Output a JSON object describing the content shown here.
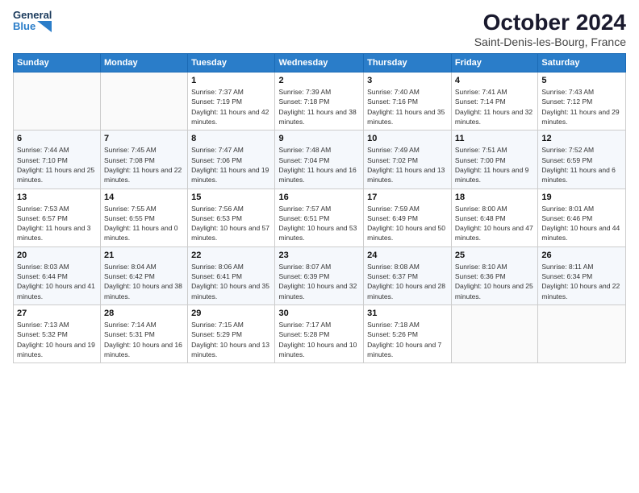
{
  "header": {
    "logo_line1": "General",
    "logo_line2": "Blue",
    "month": "October 2024",
    "location": "Saint-Denis-les-Bourg, France"
  },
  "columns": [
    "Sunday",
    "Monday",
    "Tuesday",
    "Wednesday",
    "Thursday",
    "Friday",
    "Saturday"
  ],
  "weeks": [
    [
      {
        "day": "",
        "info": ""
      },
      {
        "day": "",
        "info": ""
      },
      {
        "day": "1",
        "info": "Sunrise: 7:37 AM\nSunset: 7:19 PM\nDaylight: 11 hours and 42 minutes."
      },
      {
        "day": "2",
        "info": "Sunrise: 7:39 AM\nSunset: 7:18 PM\nDaylight: 11 hours and 38 minutes."
      },
      {
        "day": "3",
        "info": "Sunrise: 7:40 AM\nSunset: 7:16 PM\nDaylight: 11 hours and 35 minutes."
      },
      {
        "day": "4",
        "info": "Sunrise: 7:41 AM\nSunset: 7:14 PM\nDaylight: 11 hours and 32 minutes."
      },
      {
        "day": "5",
        "info": "Sunrise: 7:43 AM\nSunset: 7:12 PM\nDaylight: 11 hours and 29 minutes."
      }
    ],
    [
      {
        "day": "6",
        "info": "Sunrise: 7:44 AM\nSunset: 7:10 PM\nDaylight: 11 hours and 25 minutes."
      },
      {
        "day": "7",
        "info": "Sunrise: 7:45 AM\nSunset: 7:08 PM\nDaylight: 11 hours and 22 minutes."
      },
      {
        "day": "8",
        "info": "Sunrise: 7:47 AM\nSunset: 7:06 PM\nDaylight: 11 hours and 19 minutes."
      },
      {
        "day": "9",
        "info": "Sunrise: 7:48 AM\nSunset: 7:04 PM\nDaylight: 11 hours and 16 minutes."
      },
      {
        "day": "10",
        "info": "Sunrise: 7:49 AM\nSunset: 7:02 PM\nDaylight: 11 hours and 13 minutes."
      },
      {
        "day": "11",
        "info": "Sunrise: 7:51 AM\nSunset: 7:00 PM\nDaylight: 11 hours and 9 minutes."
      },
      {
        "day": "12",
        "info": "Sunrise: 7:52 AM\nSunset: 6:59 PM\nDaylight: 11 hours and 6 minutes."
      }
    ],
    [
      {
        "day": "13",
        "info": "Sunrise: 7:53 AM\nSunset: 6:57 PM\nDaylight: 11 hours and 3 minutes."
      },
      {
        "day": "14",
        "info": "Sunrise: 7:55 AM\nSunset: 6:55 PM\nDaylight: 11 hours and 0 minutes."
      },
      {
        "day": "15",
        "info": "Sunrise: 7:56 AM\nSunset: 6:53 PM\nDaylight: 10 hours and 57 minutes."
      },
      {
        "day": "16",
        "info": "Sunrise: 7:57 AM\nSunset: 6:51 PM\nDaylight: 10 hours and 53 minutes."
      },
      {
        "day": "17",
        "info": "Sunrise: 7:59 AM\nSunset: 6:49 PM\nDaylight: 10 hours and 50 minutes."
      },
      {
        "day": "18",
        "info": "Sunrise: 8:00 AM\nSunset: 6:48 PM\nDaylight: 10 hours and 47 minutes."
      },
      {
        "day": "19",
        "info": "Sunrise: 8:01 AM\nSunset: 6:46 PM\nDaylight: 10 hours and 44 minutes."
      }
    ],
    [
      {
        "day": "20",
        "info": "Sunrise: 8:03 AM\nSunset: 6:44 PM\nDaylight: 10 hours and 41 minutes."
      },
      {
        "day": "21",
        "info": "Sunrise: 8:04 AM\nSunset: 6:42 PM\nDaylight: 10 hours and 38 minutes."
      },
      {
        "day": "22",
        "info": "Sunrise: 8:06 AM\nSunset: 6:41 PM\nDaylight: 10 hours and 35 minutes."
      },
      {
        "day": "23",
        "info": "Sunrise: 8:07 AM\nSunset: 6:39 PM\nDaylight: 10 hours and 32 minutes."
      },
      {
        "day": "24",
        "info": "Sunrise: 8:08 AM\nSunset: 6:37 PM\nDaylight: 10 hours and 28 minutes."
      },
      {
        "day": "25",
        "info": "Sunrise: 8:10 AM\nSunset: 6:36 PM\nDaylight: 10 hours and 25 minutes."
      },
      {
        "day": "26",
        "info": "Sunrise: 8:11 AM\nSunset: 6:34 PM\nDaylight: 10 hours and 22 minutes."
      }
    ],
    [
      {
        "day": "27",
        "info": "Sunrise: 7:13 AM\nSunset: 5:32 PM\nDaylight: 10 hours and 19 minutes."
      },
      {
        "day": "28",
        "info": "Sunrise: 7:14 AM\nSunset: 5:31 PM\nDaylight: 10 hours and 16 minutes."
      },
      {
        "day": "29",
        "info": "Sunrise: 7:15 AM\nSunset: 5:29 PM\nDaylight: 10 hours and 13 minutes."
      },
      {
        "day": "30",
        "info": "Sunrise: 7:17 AM\nSunset: 5:28 PM\nDaylight: 10 hours and 10 minutes."
      },
      {
        "day": "31",
        "info": "Sunrise: 7:18 AM\nSunset: 5:26 PM\nDaylight: 10 hours and 7 minutes."
      },
      {
        "day": "",
        "info": ""
      },
      {
        "day": "",
        "info": ""
      }
    ]
  ]
}
